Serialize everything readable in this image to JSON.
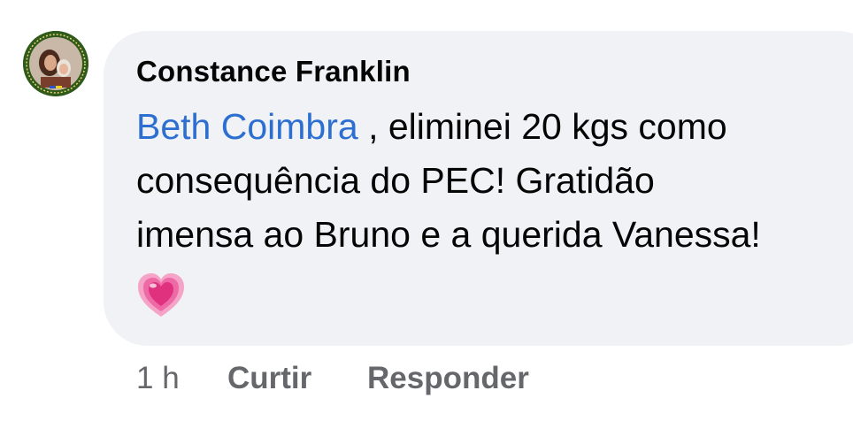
{
  "comment": {
    "author": "Constance Franklin",
    "mention": "Beth Coimbra",
    "text_line1_after_mention": " , eliminei 20 kgs como",
    "text_line2": "consequência do PEC! Gratidão",
    "text_line3": "imensa ao Bruno e a querida Vanessa!",
    "emoji": "pink-sparkling-heart",
    "timestamp": "1 h",
    "like_label": "Curtir",
    "reply_label": "Responder"
  },
  "colors": {
    "bubble": "#f0f2f5",
    "mention": "#2d6fd0",
    "text": "#050505",
    "meta": "#65676b"
  }
}
